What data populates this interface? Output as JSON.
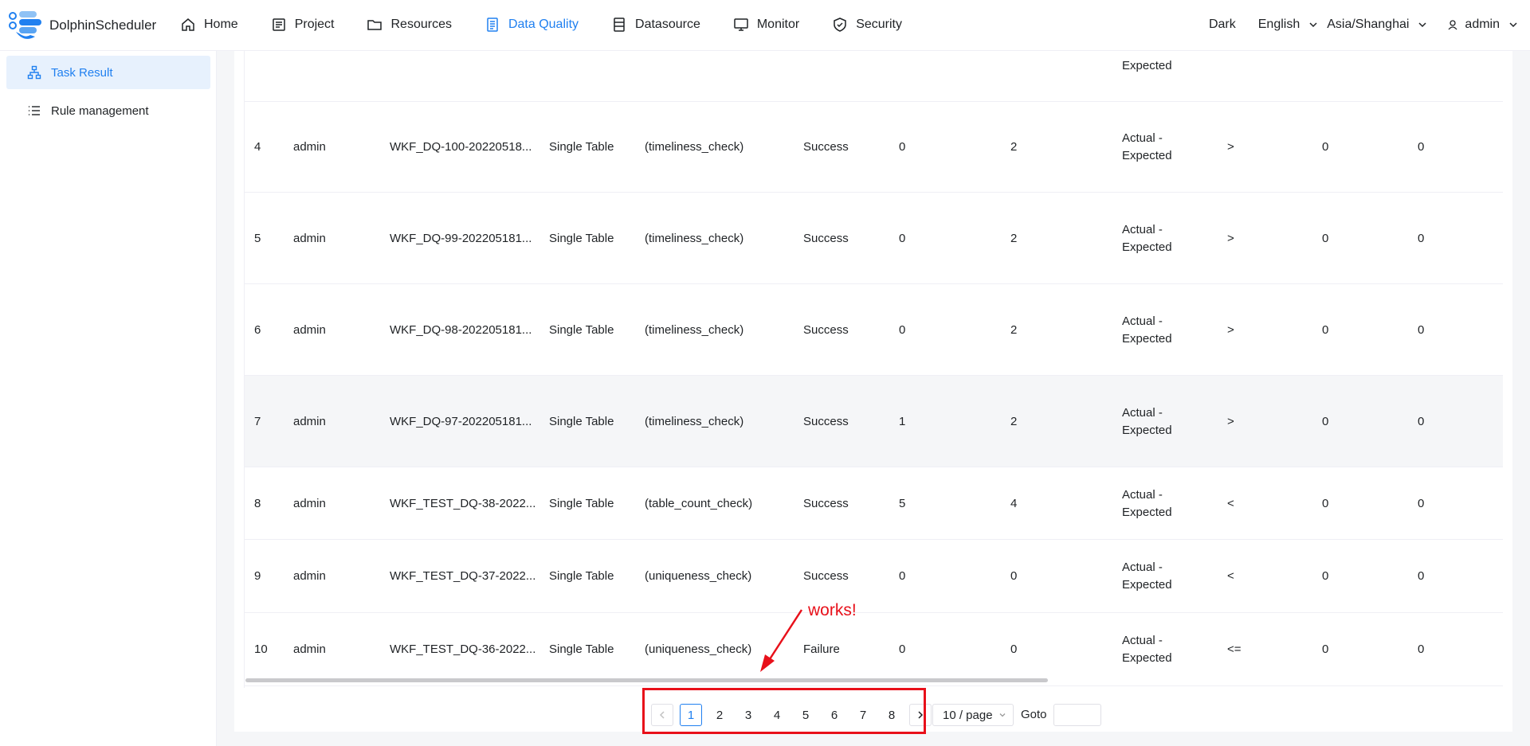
{
  "app": {
    "logo_text": "DolphinScheduler"
  },
  "nav": [
    {
      "label": "Home",
      "icon": "home-icon"
    },
    {
      "label": "Project",
      "icon": "project-icon"
    },
    {
      "label": "Resources",
      "icon": "folder-icon"
    },
    {
      "label": "Data Quality",
      "icon": "data-quality-icon",
      "active": true
    },
    {
      "label": "Datasource",
      "icon": "datasource-icon"
    },
    {
      "label": "Monitor",
      "icon": "monitor-icon"
    },
    {
      "label": "Security",
      "icon": "shield-icon"
    }
  ],
  "header_right": {
    "theme": "Dark",
    "language": "English",
    "timezone": "Asia/Shanghai",
    "user": "admin"
  },
  "sidebar": {
    "items": [
      {
        "label": "Task Result",
        "icon": "task-result-icon",
        "active": true
      },
      {
        "label": "Rule management",
        "icon": "list-icon"
      }
    ]
  },
  "table": {
    "partial_top": "Expected",
    "rows": [
      {
        "num": "4",
        "user": "admin",
        "task": "WKF_DQ-100-20220518...",
        "type": "Single Table",
        "rule": "(timeliness_check)",
        "state": "Success",
        "actual": "0",
        "expected": "2",
        "formula_1": "Actual -",
        "formula_2": "Expected",
        "operator": ">",
        "threshold": "0",
        "failure": "0"
      },
      {
        "num": "5",
        "user": "admin",
        "task": "WKF_DQ-99-202205181...",
        "type": "Single Table",
        "rule": "(timeliness_check)",
        "state": "Success",
        "actual": "0",
        "expected": "2",
        "formula_1": "Actual -",
        "formula_2": "Expected",
        "operator": ">",
        "threshold": "0",
        "failure": "0"
      },
      {
        "num": "6",
        "user": "admin",
        "task": "WKF_DQ-98-202205181...",
        "type": "Single Table",
        "rule": "(timeliness_check)",
        "state": "Success",
        "actual": "0",
        "expected": "2",
        "formula_1": "Actual -",
        "formula_2": "Expected",
        "operator": ">",
        "threshold": "0",
        "failure": "0"
      },
      {
        "num": "7",
        "user": "admin",
        "task": "WKF_DQ-97-202205181...",
        "type": "Single Table",
        "rule": "(timeliness_check)",
        "state": "Success",
        "actual": "1",
        "expected": "2",
        "formula_1": "Actual -",
        "formula_2": "Expected",
        "operator": ">",
        "threshold": "0",
        "failure": "0"
      },
      {
        "num": "8",
        "user": "admin",
        "task": "WKF_TEST_DQ-38-2022...",
        "type": "Single Table",
        "rule": "(table_count_check)",
        "state": "Success",
        "actual": "5",
        "expected": "4",
        "formula_1": "Actual -",
        "formula_2": "Expected",
        "operator": "<",
        "threshold": "0",
        "failure": "0"
      },
      {
        "num": "9",
        "user": "admin",
        "task": "WKF_TEST_DQ-37-2022...",
        "type": "Single Table",
        "rule": "(uniqueness_check)",
        "state": "Success",
        "actual": "0",
        "expected": "0",
        "formula_1": "Actual -",
        "formula_2": "Expected",
        "operator": "<",
        "threshold": "0",
        "failure": "0"
      },
      {
        "num": "10",
        "user": "admin",
        "task": "WKF_TEST_DQ-36-2022...",
        "type": "Single Table",
        "rule": "(uniqueness_check)",
        "state": "Failure",
        "actual": "0",
        "expected": "0",
        "formula_1": "Actual -",
        "formula_2": "Expected",
        "operator": "<=",
        "threshold": "0",
        "failure": "0"
      }
    ]
  },
  "pagination": {
    "pages": [
      "1",
      "2",
      "3",
      "4",
      "5",
      "6",
      "7",
      "8"
    ],
    "current": "1",
    "page_size": "10 / page",
    "goto_label": "Goto",
    "goto_value": ""
  },
  "annotation": {
    "text": "works!",
    "color": "#e8101a"
  },
  "colors": {
    "accent": "#2080f0",
    "border": "#efeff5",
    "annotation": "#e8101a"
  }
}
